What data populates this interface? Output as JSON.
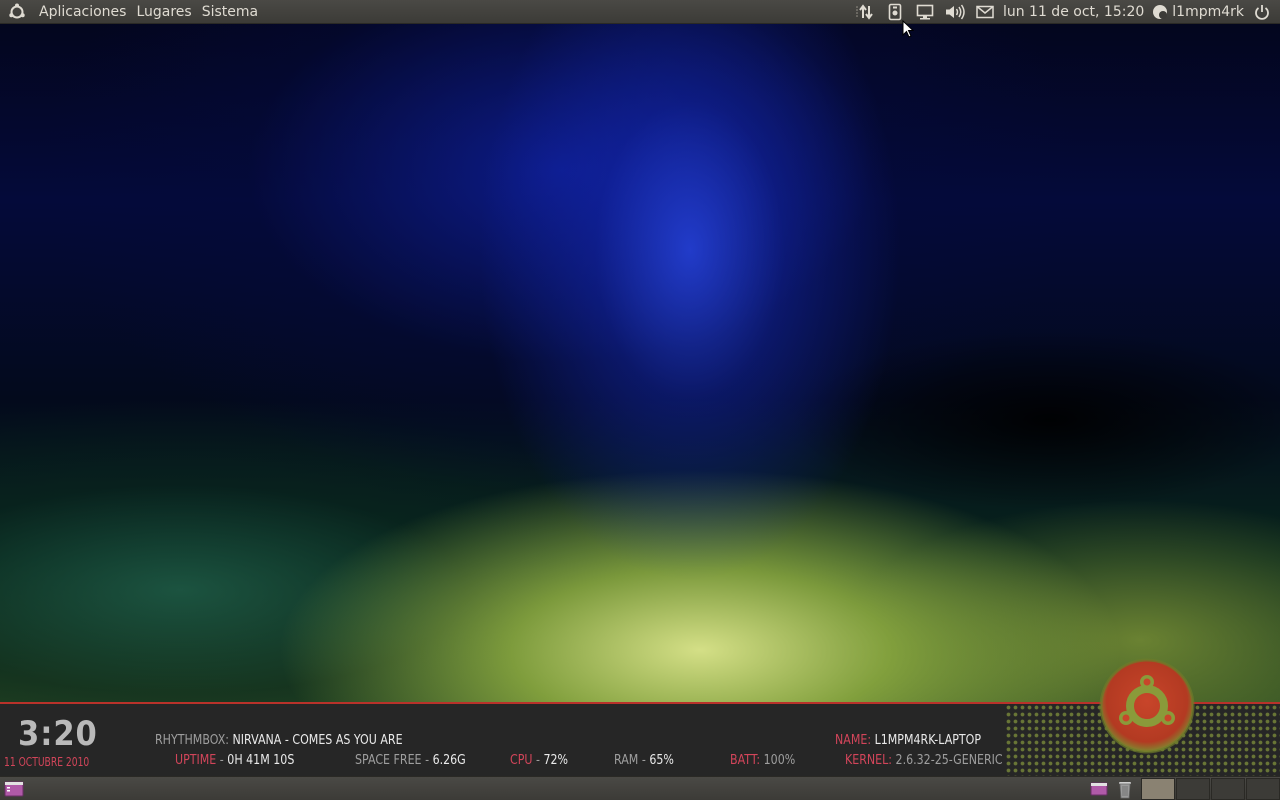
{
  "top_panel": {
    "menus": [
      "Aplicaciones",
      "Lugares",
      "Sistema"
    ],
    "clock": "lun 11 de oct, 15:20",
    "user": "l1mpm4rk",
    "tray_icons": [
      "network-arrows-icon",
      "usb-device-icon",
      "display-icon",
      "volume-icon",
      "mail-icon"
    ]
  },
  "conky": {
    "clock": "3:20",
    "date": "11 octubre 2010",
    "rhythmbox_label": "Rhythmbox:",
    "rhythmbox_track": "nirvana - comes as you are",
    "name_label": "name:",
    "name_value": "L1mpm4rk-laptop",
    "uptime_label": "uptime",
    "uptime_sep": " - ",
    "uptime_value": "0h 41m 10s",
    "space_label": "space free",
    "space_sep": " - ",
    "space_value": "6.26G",
    "cpu_label": "cpu",
    "cpu_sep": " - ",
    "cpu_value": "72%",
    "ram_label": "ram",
    "ram_sep": " - ",
    "ram_value": "65%",
    "batt_label": "batt:",
    "batt_value": "100%",
    "kernel_label": "kernel:",
    "kernel_value": "2.6.32-25-generic"
  },
  "colors": {
    "panel": "#3c3b37",
    "conky_bg": "#262626",
    "accent_red": "#d2455a",
    "ubuntu_orange": "#c8452a"
  },
  "bottom_panel": {
    "workspaces": 4,
    "active_workspace": 1
  }
}
